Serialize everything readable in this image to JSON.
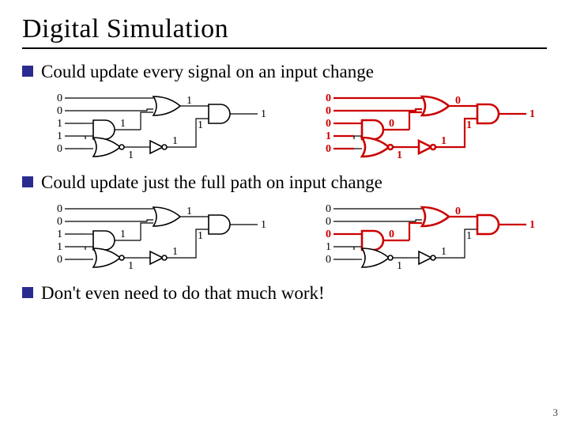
{
  "title": "Digital Simulation",
  "bullets": [
    "Could update every signal on an input change",
    "Could update just the full path on input change",
    "Don't even need to do that much work!"
  ],
  "page_number": "3",
  "circuits": {
    "A_left": {
      "inputs": [
        "0",
        "0",
        "1",
        "1",
        "0"
      ],
      "g1_out": "1",
      "g2_out": "1",
      "g3_out": "1",
      "inv_in": "1",
      "inv_out": "1",
      "final": "1",
      "highlight": "none"
    },
    "A_right": {
      "inputs": [
        "0",
        "0",
        "0",
        "1",
        "0"
      ],
      "g1_out": "0",
      "g2_out": "1",
      "g3_out": "0",
      "inv_in": "1",
      "inv_out": "1",
      "final": "1",
      "highlight": "all_red"
    },
    "B_left": {
      "inputs": [
        "0",
        "0",
        "1",
        "1",
        "0"
      ],
      "g1_out": "1",
      "g2_out": "1",
      "g3_out": "1",
      "inv_in": "1",
      "inv_out": "1",
      "final": "1",
      "highlight": "none"
    },
    "B_right": {
      "inputs": [
        "0",
        "0",
        "0",
        "1",
        "0"
      ],
      "g1_out": "0",
      "g2_out": "1",
      "g3_out": "0",
      "inv_in": "1",
      "inv_out": "1",
      "final": "1",
      "highlight": "path_red"
    }
  }
}
